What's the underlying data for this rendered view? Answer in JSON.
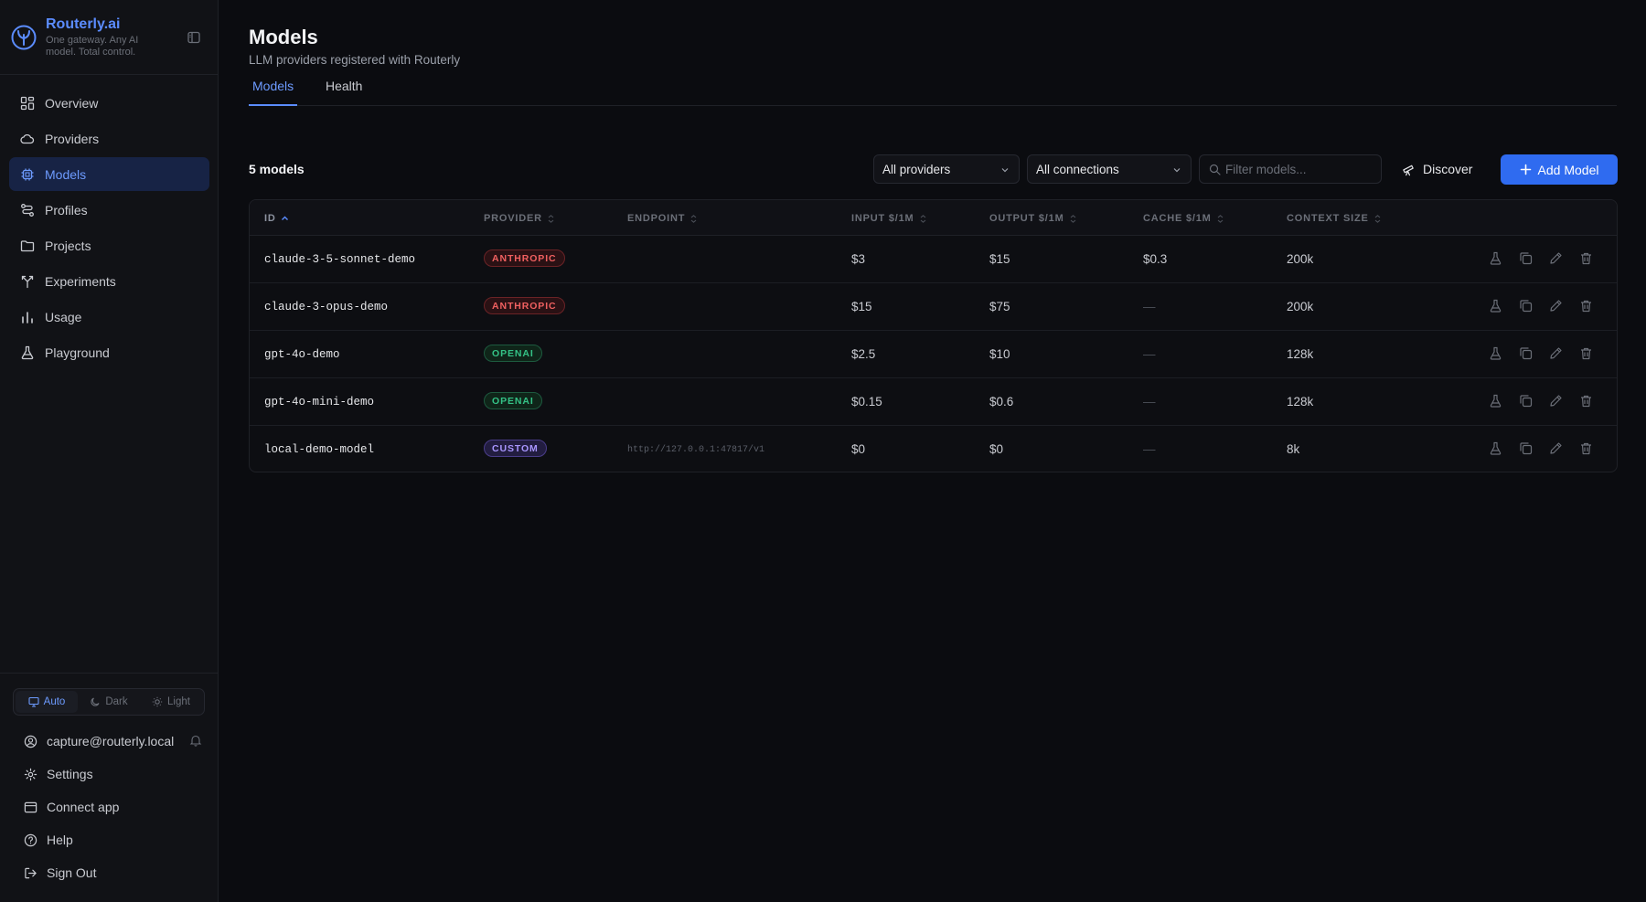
{
  "brand": {
    "name": "Routerly.ai",
    "tagline": "One gateway. Any AI model. Total control.",
    "logo_icon": "routerly-logo-icon",
    "accent": "#5b8cff"
  },
  "sidebar": {
    "items": [
      {
        "label": "Overview",
        "icon": "grid-icon",
        "active": false
      },
      {
        "label": "Providers",
        "icon": "cloud-icon",
        "active": false
      },
      {
        "label": "Models",
        "icon": "cpu-icon",
        "active": true
      },
      {
        "label": "Profiles",
        "icon": "route-icon",
        "active": false
      },
      {
        "label": "Projects",
        "icon": "folder-icon",
        "active": false
      },
      {
        "label": "Experiments",
        "icon": "branch-icon",
        "active": false
      },
      {
        "label": "Usage",
        "icon": "bar-chart-icon",
        "active": false
      },
      {
        "label": "Playground",
        "icon": "flask-icon",
        "active": false
      }
    ],
    "theme": {
      "options": [
        {
          "label": "Auto",
          "icon": "monitor-icon",
          "active": true
        },
        {
          "label": "Dark",
          "icon": "moon-icon",
          "active": false
        },
        {
          "label": "Light",
          "icon": "sun-icon",
          "active": false
        }
      ]
    },
    "user_email": "capture@routerly.local",
    "bottom_items": [
      {
        "label": "Settings",
        "icon": "gear-icon"
      },
      {
        "label": "Connect app",
        "icon": "window-icon"
      },
      {
        "label": "Help",
        "icon": "help-circle-icon"
      },
      {
        "label": "Sign Out",
        "icon": "sign-out-icon"
      }
    ]
  },
  "header": {
    "title": "Models",
    "subtitle": "LLM providers registered with Routerly",
    "tabs": [
      {
        "label": "Models",
        "active": true
      },
      {
        "label": "Health",
        "active": false
      }
    ]
  },
  "toolbar": {
    "count_label": "5 models",
    "provider_filter": "All providers",
    "connection_filter": "All connections",
    "search_placeholder": "Filter models...",
    "discover_label": "Discover",
    "add_label": "Add Model"
  },
  "table": {
    "columns": [
      "ID",
      "PROVIDER",
      "ENDPOINT",
      "INPUT $/1M",
      "OUTPUT $/1M",
      "CACHE $/1M",
      "CONTEXT SIZE"
    ],
    "sorted_column": "ID",
    "sort_direction": "ascending",
    "rows": [
      {
        "id": "claude-3-5-sonnet-demo",
        "provider": "ANTHROPIC",
        "provider_key": "anthropic",
        "endpoint": "",
        "input": "$3",
        "output": "$15",
        "cache": "$0.3",
        "context": "200k"
      },
      {
        "id": "claude-3-opus-demo",
        "provider": "ANTHROPIC",
        "provider_key": "anthropic",
        "endpoint": "",
        "input": "$15",
        "output": "$75",
        "cache": "—",
        "context": "200k"
      },
      {
        "id": "gpt-4o-demo",
        "provider": "OPENAI",
        "provider_key": "openai",
        "endpoint": "",
        "input": "$2.5",
        "output": "$10",
        "cache": "—",
        "context": "128k"
      },
      {
        "id": "gpt-4o-mini-demo",
        "provider": "OPENAI",
        "provider_key": "openai",
        "endpoint": "",
        "input": "$0.15",
        "output": "$0.6",
        "cache": "—",
        "context": "128k"
      },
      {
        "id": "local-demo-model",
        "provider": "CUSTOM",
        "provider_key": "custom",
        "endpoint": "http://127.0.0.1:47817/v1",
        "input": "$0",
        "output": "$0",
        "cache": "—",
        "context": "8k"
      }
    ],
    "row_actions": [
      "flask-icon",
      "copy-icon",
      "edit-icon",
      "trash-icon"
    ]
  }
}
